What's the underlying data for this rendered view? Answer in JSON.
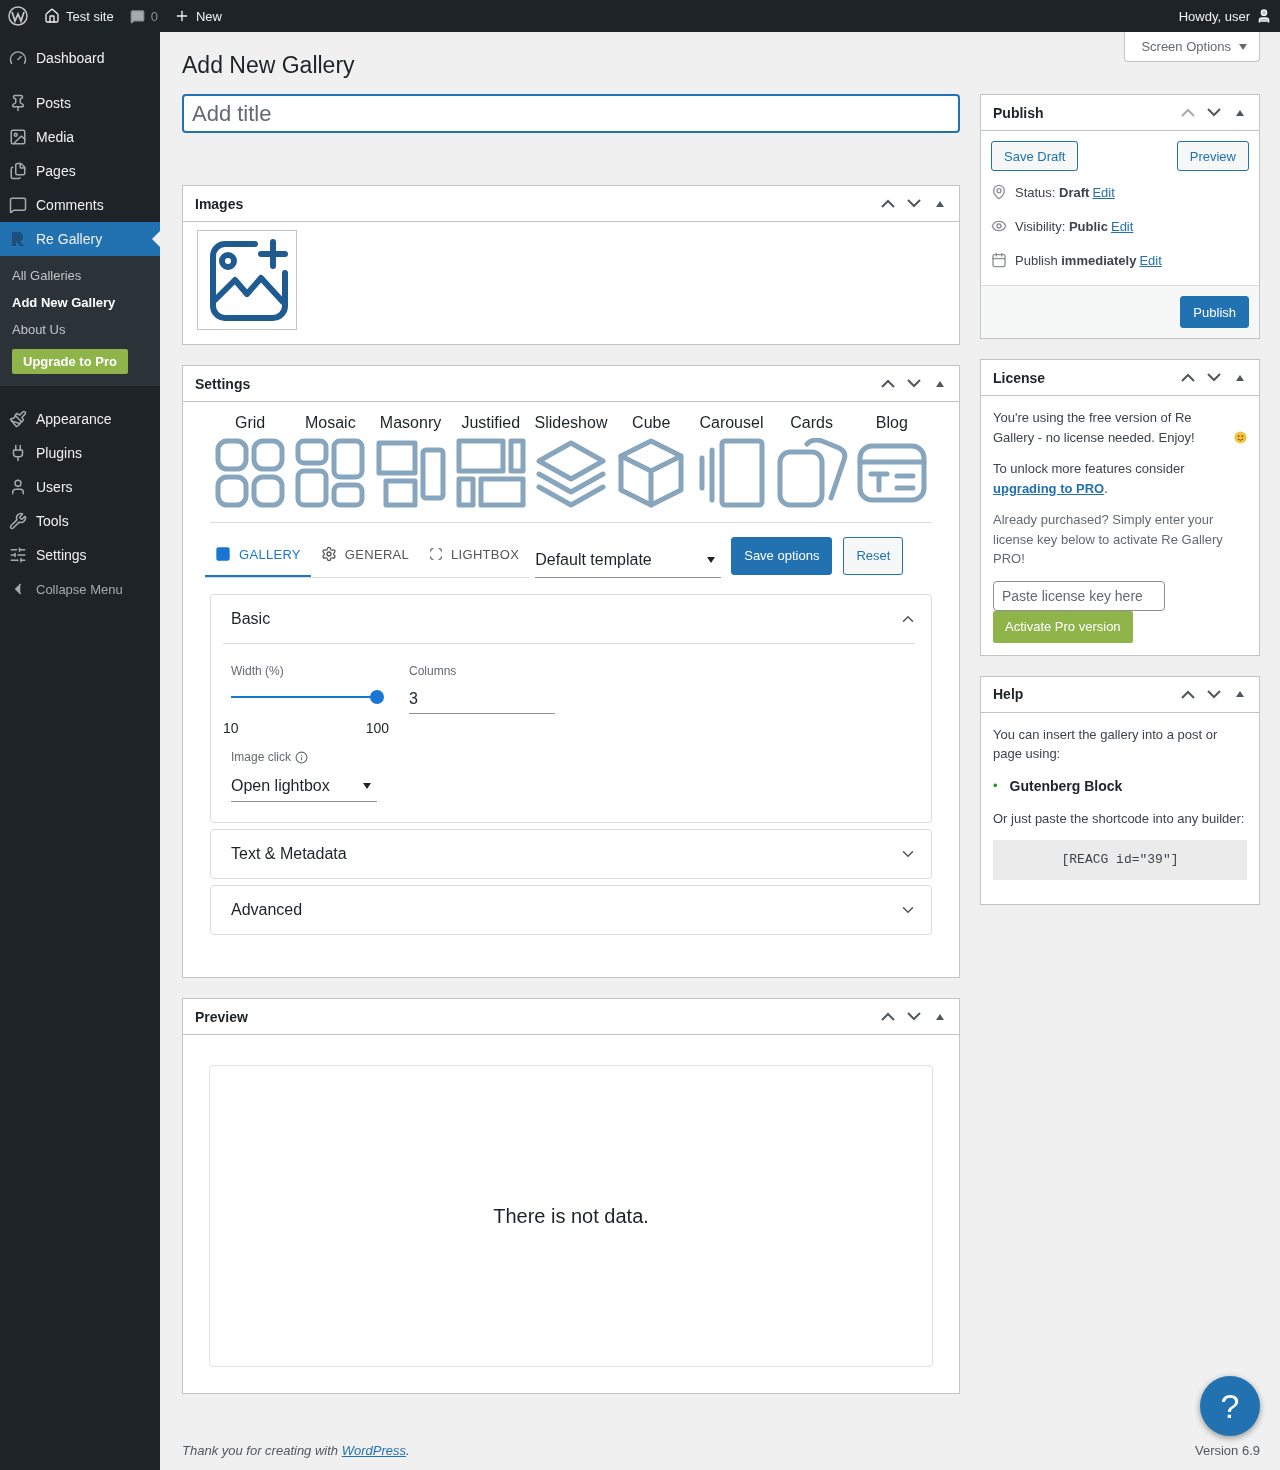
{
  "admin_bar": {
    "site": "Test site",
    "comments": "0",
    "new": "New",
    "greeting": "Howdy, user"
  },
  "sidebar": {
    "items": [
      {
        "label": "Dashboard",
        "selected": false
      },
      {
        "label": "Posts",
        "selected": false
      },
      {
        "label": "Media",
        "selected": false
      },
      {
        "label": "Pages",
        "selected": false
      },
      {
        "label": "Comments",
        "selected": false
      },
      {
        "label": "Re Gallery",
        "selected": true,
        "children": [
          {
            "label": "All Galleries",
            "kind": "link",
            "selected": false
          },
          {
            "label": "Add New Gallery",
            "kind": "link",
            "selected": true
          },
          {
            "label": "About Us",
            "kind": "link",
            "selected": false
          },
          {
            "label": "Upgrade to Pro",
            "kind": "button"
          }
        ]
      },
      {
        "label": "Appearance",
        "selected": false
      },
      {
        "label": "Plugins",
        "selected": false
      },
      {
        "label": "Users",
        "selected": false
      },
      {
        "label": "Tools",
        "selected": false
      },
      {
        "label": "Settings",
        "selected": false
      },
      {
        "label": "Collapse Menu",
        "selected": false
      }
    ]
  },
  "screen_options": "Screen Options",
  "page_title": "Add New Gallery",
  "title_field": {
    "placeholder": "Add title"
  },
  "images_box": {
    "title": "Images",
    "up_disabled": false
  },
  "settings_box": {
    "title": "Settings",
    "up_disabled": false,
    "layouts": [
      {
        "label": "Grid",
        "kind": "grid"
      },
      {
        "label": "Mosaic",
        "kind": "mosaic"
      },
      {
        "label": "Masonry",
        "kind": "masonry"
      },
      {
        "label": "Justified",
        "kind": "justified"
      },
      {
        "label": "Slideshow",
        "kind": "slideshow"
      },
      {
        "label": "Cube",
        "kind": "cube"
      },
      {
        "label": "Carousel",
        "kind": "carousel"
      },
      {
        "label": "Cards",
        "kind": "cards"
      },
      {
        "label": "Blog",
        "kind": "blog"
      }
    ],
    "tabs": [
      {
        "label": "GALLERY",
        "selected": true
      },
      {
        "label": "GENERAL",
        "selected": false
      },
      {
        "label": "LIGHTBOX",
        "selected": false
      }
    ],
    "template": "Default template",
    "save_button": "Save options",
    "reset_button": "Reset",
    "sections": [
      {
        "title": "Basic",
        "expanded": true
      },
      {
        "title": "Text & Metadata",
        "expanded": false
      },
      {
        "title": "Advanced",
        "expanded": false
      }
    ],
    "basic": {
      "width_label": "Width (%)",
      "width_min": "10",
      "width_max": "100",
      "level": 1.0,
      "columns_label": "Columns",
      "columns_value": "3",
      "click_label": "Image click",
      "click_value": "Open lightbox"
    }
  },
  "preview_box": {
    "title": "Preview",
    "up_disabled": false,
    "empty_text": "There is not data."
  },
  "publish_box": {
    "title": "Publish",
    "up_disabled": true,
    "save_draft": "Save Draft",
    "preview": "Preview",
    "rows": [
      {
        "text": "Status: **Draft**",
        "link": "Edit"
      },
      {
        "text": "Visibility: **Public**",
        "link": "Edit"
      },
      {
        "text": "Publish **immediately**",
        "link": "Edit"
      }
    ],
    "publish_button": "Publish"
  },
  "license_box": {
    "title": "License",
    "up_disabled": false,
    "intro": "You're using the free version of Re Gallery - no license needed. Enjoy!",
    "unlock_text": "To unlock more features consider",
    "unlock_link": "upgrading to PRO",
    "unlock_end": ".",
    "purchased": "Already purchased? Simply enter your license key below to activate Re Gallery PRO!",
    "key_placeholder": "Paste license key here",
    "activate_button": "Activate Pro version"
  },
  "help_box": {
    "title": "Help",
    "up_disabled": false,
    "text": "You can insert the gallery into a post or page using:",
    "bullets": [
      {
        "marker": "•",
        "text": "Gutenberg Block"
      }
    ],
    "shortcode_text": "Or just paste the shortcode into any builder:",
    "shortcode": "[REACG id=\"39\"]"
  },
  "footer": {
    "text": "Thank you for creating with",
    "link": "WordPress",
    "end": ".",
    "version": "Version 6.9"
  },
  "help_button": "?"
}
